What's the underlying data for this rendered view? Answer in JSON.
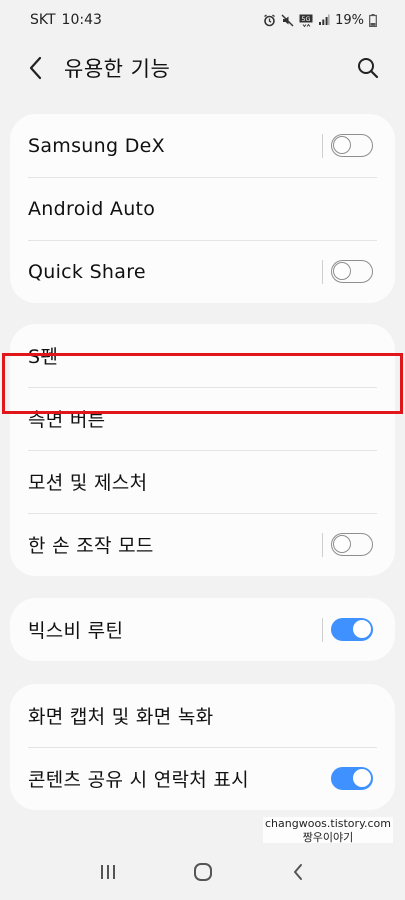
{
  "status_bar": {
    "carrier": "SKT",
    "time": "10:43",
    "battery": "19%",
    "icons": [
      "alarm-icon",
      "mute-icon",
      "5g-icon",
      "signal-icon",
      "battery-icon"
    ]
  },
  "header": {
    "title": "유용한 기능",
    "back_icon": "chevron-left-icon",
    "search_icon": "search-icon"
  },
  "groups": [
    {
      "items": [
        {
          "label": "Samsung DeX",
          "toggle": "off"
        },
        {
          "label": "Android Auto",
          "toggle": null
        },
        {
          "label": "Quick Share",
          "toggle": "off"
        }
      ]
    },
    {
      "items": [
        {
          "label": "S펜",
          "toggle": null
        },
        {
          "label": "측면 버튼",
          "toggle": null
        },
        {
          "label": "모션 및 제스처",
          "toggle": null
        },
        {
          "label": "한 손 조작 모드",
          "toggle": "off"
        }
      ]
    },
    {
      "items": [
        {
          "label": "빅스비 루틴",
          "toggle": "on"
        }
      ]
    },
    {
      "items": [
        {
          "label": "화면 캡처 및 화면 녹화",
          "toggle": null
        },
        {
          "label": "콘텐츠 공유 시 연락처 표시",
          "toggle": "on"
        }
      ]
    }
  ],
  "watermark": {
    "line1": "changwoos.tistory.com",
    "line2": "짱우이야기"
  },
  "colors": {
    "toggle_on": "#3e91ff",
    "highlight": "#e0161b",
    "background": "#f2f2f2",
    "card": "#fcfcfc"
  },
  "nav_bar": {
    "icons": [
      "recents-icon",
      "home-icon",
      "back-icon"
    ]
  }
}
